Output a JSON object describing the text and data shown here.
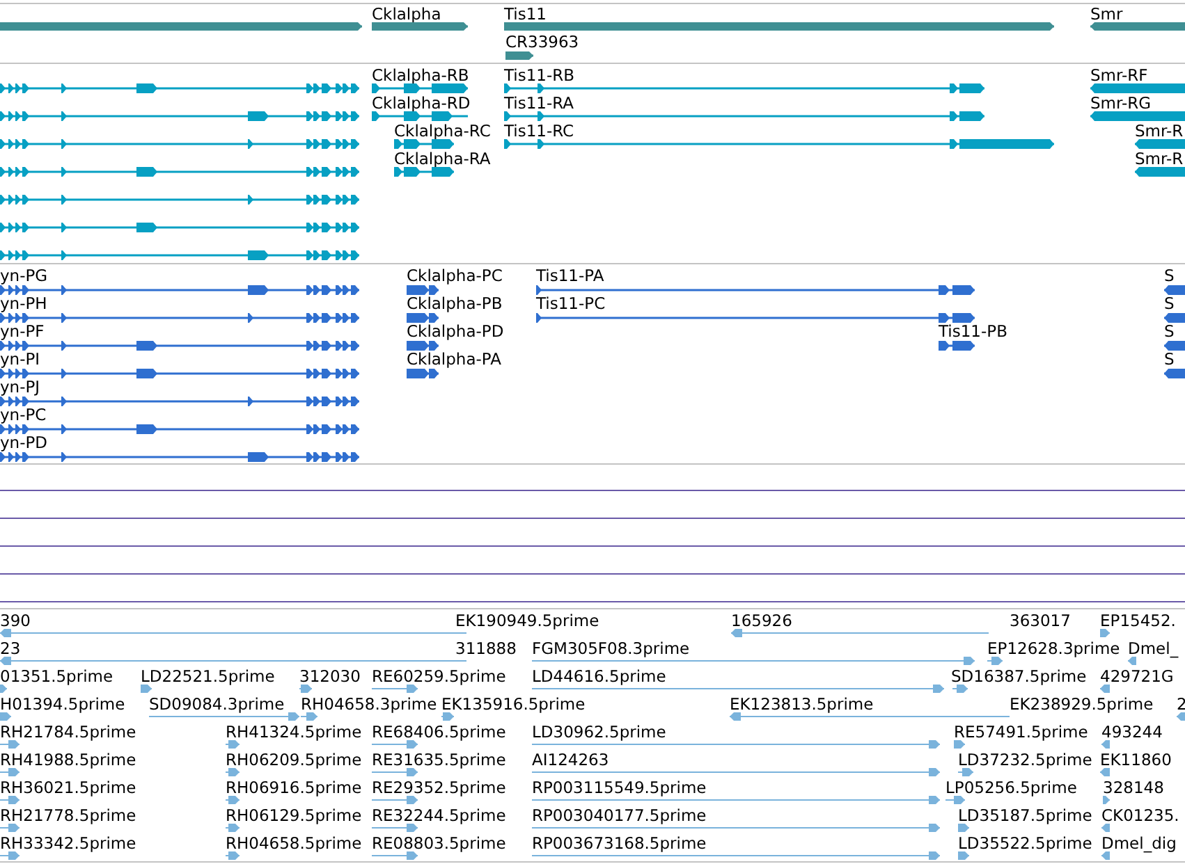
{
  "tracks": [
    {
      "kind": "genes",
      "features": [
        {
          "label": "Cklalpha"
        },
        {
          "label": "Tis11"
        },
        {
          "label": "CR33963"
        },
        {
          "label": "Smr"
        }
      ]
    },
    {
      "kind": "transcripts",
      "features": [
        {
          "label": "Cklalpha-RB"
        },
        {
          "label": "Cklalpha-RD"
        },
        {
          "label": "Cklalpha-RC"
        },
        {
          "label": "Cklalpha-RA"
        },
        {
          "label": "Tis11-RB"
        },
        {
          "label": "Tis11-RA"
        },
        {
          "label": "Tis11-RC"
        },
        {
          "label": "Smr-RF"
        },
        {
          "label": "Smr-RG"
        },
        {
          "label": "Smr-R"
        },
        {
          "label": "Smr-R"
        }
      ]
    },
    {
      "kind": "proteins",
      "features": [
        {
          "label": "yn-PG"
        },
        {
          "label": "yn-PH"
        },
        {
          "label": "yn-PF"
        },
        {
          "label": "yn-PI"
        },
        {
          "label": "yn-PJ"
        },
        {
          "label": "yn-PC"
        },
        {
          "label": "yn-PD"
        },
        {
          "label": "Cklalpha-PC"
        },
        {
          "label": "Cklalpha-PB"
        },
        {
          "label": "Cklalpha-PD"
        },
        {
          "label": "Cklalpha-PA"
        },
        {
          "label": "Tis11-PA"
        },
        {
          "label": "Tis11-PC"
        },
        {
          "label": "Tis11-PB"
        },
        {
          "label": "S"
        },
        {
          "label": "S"
        },
        {
          "label": "S"
        },
        {
          "label": "S"
        }
      ]
    },
    {
      "kind": "lines"
    },
    {
      "kind": "ests",
      "features": [
        {
          "label": "390"
        },
        {
          "label": "EK190949.5prime"
        },
        {
          "label": "165926"
        },
        {
          "label": "363017"
        },
        {
          "label": "EP15452."
        },
        {
          "label": "23"
        },
        {
          "label": "311888"
        },
        {
          "label": "FGM305F08.3prime"
        },
        {
          "label": "EP12628.3prime"
        },
        {
          "label": "Dmel_"
        },
        {
          "label": "01351.5prime"
        },
        {
          "label": "LD22521.5prime"
        },
        {
          "label": "312030"
        },
        {
          "label": "RE60259.5prime"
        },
        {
          "label": "LD44616.5prime"
        },
        {
          "label": "SD16387.5prime"
        },
        {
          "label": "429721G"
        },
        {
          "label": "H01394.5prime"
        },
        {
          "label": "SD09084.3prime"
        },
        {
          "label": "RH04658.3prime"
        },
        {
          "label": "EK135916.5prime"
        },
        {
          "label": "EK123813.5prime"
        },
        {
          "label": "EK238929.5prime"
        },
        {
          "label": "2"
        },
        {
          "label": "RH21784.5prime"
        },
        {
          "label": "RH41324.5prime"
        },
        {
          "label": "RE68406.5prime"
        },
        {
          "label": "LD30962.5prime"
        },
        {
          "label": "RE57491.5prime"
        },
        {
          "label": "493244"
        },
        {
          "label": "RH41988.5prime"
        },
        {
          "label": "RH06209.5prime"
        },
        {
          "label": "RE31635.5prime"
        },
        {
          "label": "AI124263"
        },
        {
          "label": "LD37232.5prime"
        },
        {
          "label": "EK11860"
        },
        {
          "label": "RH36021.5prime"
        },
        {
          "label": "RH06916.5prime"
        },
        {
          "label": "RE29352.5prime"
        },
        {
          "label": "RP003115549.5prime"
        },
        {
          "label": "LP05256.5prime"
        },
        {
          "label": "328148"
        },
        {
          "label": "RH21778.5prime"
        },
        {
          "label": "RH06129.5prime"
        },
        {
          "label": "RE32244.5prime"
        },
        {
          "label": "RP003040177.5prime"
        },
        {
          "label": "LD35187.5prime"
        },
        {
          "label": "CK01235."
        },
        {
          "label": "RH33342.5prime"
        },
        {
          "label": "RH04658.5prime"
        },
        {
          "label": "RE08803.5prime"
        },
        {
          "label": "RP003673168.5prime"
        },
        {
          "label": "LD35522.5prime"
        },
        {
          "label": "Dmel_dig"
        }
      ]
    }
  ]
}
